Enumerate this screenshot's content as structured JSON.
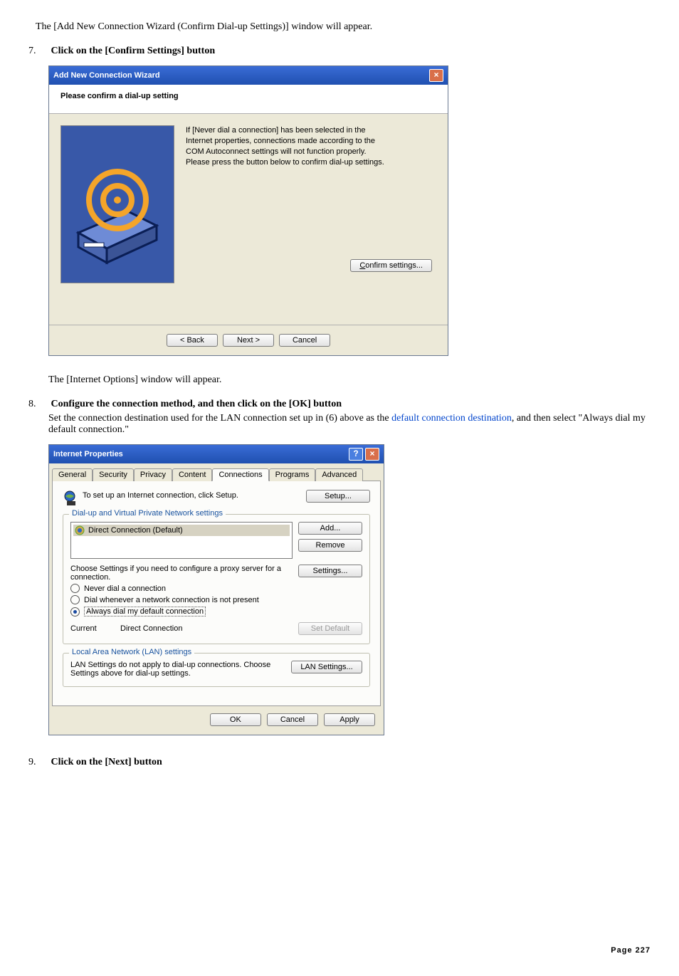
{
  "intro_text": "The [Add New Connection Wizard (Confirm Dial-up Settings)] window will appear.",
  "step7": {
    "num": "7.",
    "title": "Click on the [Confirm Settings] button"
  },
  "wizard": {
    "title": "Add New Connection Wizard",
    "subheader": "Please confirm a dial-up setting",
    "desc_l1": "If [Never dial a connection] has been selected in the",
    "desc_l2": "Internet properties, connections made according to the",
    "desc_l3": "COM Autoconnect settings will not function properly.",
    "desc_l4": "Please press the button below to confirm dial-up settings.",
    "confirm_btn": "Confirm settings...",
    "back_btn": "< Back",
    "next_btn": "Next >",
    "cancel_btn": "Cancel"
  },
  "post_wizard": "The [Internet Options] window will appear.",
  "step8": {
    "num": "8.",
    "title": "Configure the connection method, and then click on the [OK] button",
    "body_pre": "Set the connection destination used for the LAN connection set up in (6) above as the ",
    "body_link": "default connection destination",
    "body_post": ", and then select \"Always dial my default connection.\""
  },
  "props": {
    "title": "Internet Properties",
    "tabs": [
      "General",
      "Security",
      "Privacy",
      "Content",
      "Connections",
      "Programs",
      "Advanced"
    ],
    "setup_text": "To set up an Internet connection, click Setup.",
    "setup_btn": "Setup...",
    "fieldset1_legend": "Dial-up and Virtual Private Network settings",
    "list_item": "Direct Connection (Default)",
    "add_btn": "Add...",
    "remove_btn": "Remove",
    "choose_text": "Choose Settings if you need to configure a proxy server for a connection.",
    "settings_btn": "Settings...",
    "radio_never": "Never dial a connection",
    "radio_whenever": "Dial whenever a network connection is not present",
    "radio_always": "Always dial my default connection",
    "current_label": "Current",
    "current_value": "Direct Connection",
    "set_default_btn": "Set Default",
    "fieldset2_legend": "Local Area Network (LAN) settings",
    "lan_text": "LAN Settings do not apply to dial-up connections. Choose Settings above for dial-up settings.",
    "lan_btn": "LAN Settings...",
    "ok_btn": "OK",
    "cancel_btn": "Cancel",
    "apply_btn": "Apply"
  },
  "step9": {
    "num": "9.",
    "title": "Click on the [Next] button"
  },
  "footer": {
    "label": "Page ",
    "num": "227"
  }
}
